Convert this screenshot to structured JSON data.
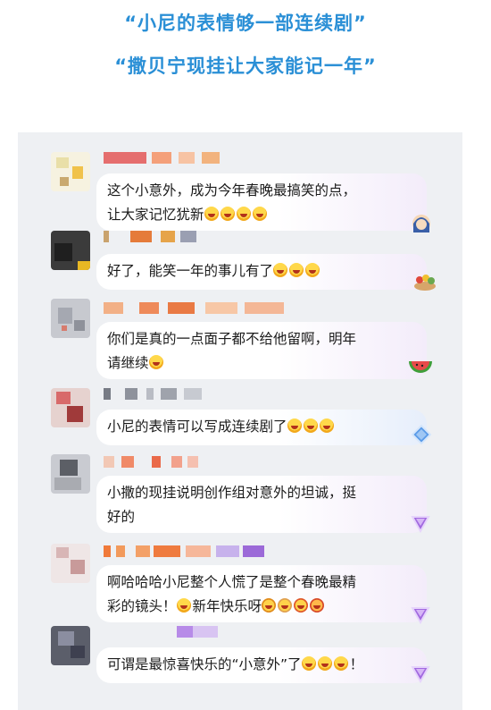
{
  "headings": {
    "line1": "“小尼的表情够一部连续剧”",
    "line2": "“撒贝宁现挂让大家能记一年”"
  },
  "comments": [
    {
      "text": "这个小意外，成为今年春晚最搞笑的点，\n让大家记忆犹新",
      "emoji_count": 4,
      "badge_icon": "girl-sticker-icon"
    },
    {
      "text": "好了，能笑一年的事儿有了",
      "emoji_count": 3,
      "badge_icon": "flower-bowl-icon"
    },
    {
      "text": "你们是真的一点面子都不给他留啊，明年\n请继续",
      "emoji_count": 1,
      "badge_icon": "watermelon-icon"
    },
    {
      "text": "小尼的表情可以写成连续剧了",
      "emoji_count": 3,
      "badge_icon": "blue-diamond-icon"
    },
    {
      "text": "小撒的现挂说明创作组对意外的坦诚，挺\n好的",
      "emoji_count": 0,
      "badge_icon": "purple-diamond-icon"
    },
    {
      "text": "啊哈哈哈小尼整个人慌了是整个春晚最精\n彩的镜头！",
      "after_text": "新年快乐呀",
      "emoji_count": 1,
      "sticker_count": 4,
      "badge_icon": "purple-diamond-icon"
    },
    {
      "text": "可谓是最惊喜快乐的“小意外”了",
      "after_text": "！",
      "emoji_count": 3,
      "badge_icon": "purple-diamond-icon"
    }
  ]
}
